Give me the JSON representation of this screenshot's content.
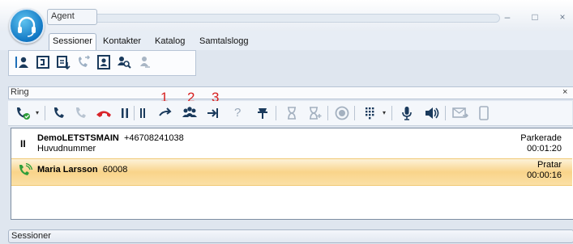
{
  "window": {
    "app_name": "Agent",
    "controls": {
      "minimize": "–",
      "maximize": "□",
      "close": "×"
    }
  },
  "tabs": [
    {
      "label": "Sessioner",
      "active": true
    },
    {
      "label": "Kontakter",
      "active": false
    },
    {
      "label": "Katalog",
      "active": false
    },
    {
      "label": "Samtalslogg",
      "active": false
    }
  ],
  "main_toolbar": {
    "icons": [
      "agent-status-icon",
      "phone-panel-icon",
      "report-icon",
      "forward-call-icon",
      "contact-card-icon",
      "search-person-icon",
      "transfer-person-icon"
    ]
  },
  "ring_panel": {
    "label": "Ring",
    "close": "×"
  },
  "annotations": [
    "1",
    "2",
    "3"
  ],
  "call_toolbar": {
    "icons": [
      "answer-icon",
      "call-icon",
      "redial-icon",
      "hangup-icon",
      "hold-icon",
      "transfer-icon",
      "conference-icon",
      "consult-transfer-icon",
      "help-icon",
      "pin-icon",
      "timer-icon",
      "timer-add-icon",
      "record-icon",
      "dialpad-icon",
      "mute-microphone-icon",
      "speaker-icon",
      "message-icon",
      "mobile-icon"
    ],
    "help_glyph": "?"
  },
  "sessions": [
    {
      "name": "DemoLETSTSMAIN",
      "number": "+46708241038",
      "subtitle": "Huvudnummer",
      "status": "Parkerade",
      "time": "00:01:20",
      "state_symbol": "II"
    },
    {
      "name": "Maria Larsson",
      "number": "60008",
      "status": "Pratar",
      "time": "00:00:16"
    }
  ],
  "status_bar": {
    "label": "Sessioner"
  },
  "colors": {
    "accent": "#1177c4",
    "active_row": "#f9d48a",
    "annotation": "#d72020",
    "hangup": "#d8242a",
    "answer_green": "#2e9e3a"
  }
}
